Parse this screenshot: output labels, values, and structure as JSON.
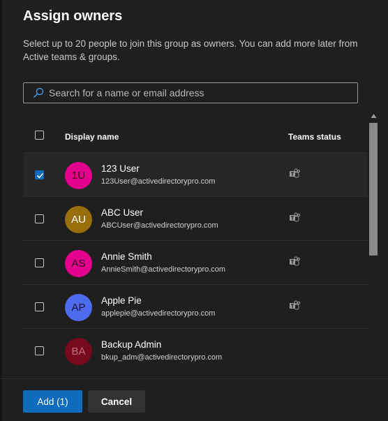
{
  "dialog": {
    "title": "Assign owners",
    "description": "Select up to 20 people to join this group as owners. You can add more later from Active teams & groups."
  },
  "search": {
    "placeholder": "Search for a name or email address",
    "value": ""
  },
  "table": {
    "columns": {
      "display_name": "Display name",
      "teams_status": "Teams status"
    },
    "rows": [
      {
        "initials": "1U",
        "name": "123 User",
        "email": "123User@activedirectorypro.com",
        "checked": true,
        "avatar_color": "#e3008c",
        "avatar_text_color": "#2a0018",
        "teams_icon": "teams-icon"
      },
      {
        "initials": "AU",
        "name": "ABC User",
        "email": "ABCUser@activedirectorypro.com",
        "checked": false,
        "avatar_color": "#986f0b",
        "avatar_text_color": "#ffffff",
        "teams_icon": "teams-icon"
      },
      {
        "initials": "AS",
        "name": "Annie Smith",
        "email": "AnnieSmith@activedirectorypro.com",
        "checked": false,
        "avatar_color": "#e3008c",
        "avatar_text_color": "#2a0018",
        "teams_icon": "teams-icon"
      },
      {
        "initials": "AP",
        "name": "Apple Pie",
        "email": "applepie@activedirectorypro.com",
        "checked": false,
        "avatar_color": "#4f6bed",
        "avatar_text_color": "#0a1030",
        "teams_icon": "teams-icon"
      },
      {
        "initials": "BA",
        "name": "Backup Admin",
        "email": "bkup_adm@activedirectorypro.com",
        "checked": false,
        "avatar_color": "#750b1c",
        "avatar_text_color": "#c0707c",
        "teams_icon": ""
      }
    ]
  },
  "footer": {
    "add_label": "Add (1)",
    "cancel_label": "Cancel"
  },
  "colors": {
    "accent": "#0f6cbd",
    "background": "#1f1f1f"
  }
}
